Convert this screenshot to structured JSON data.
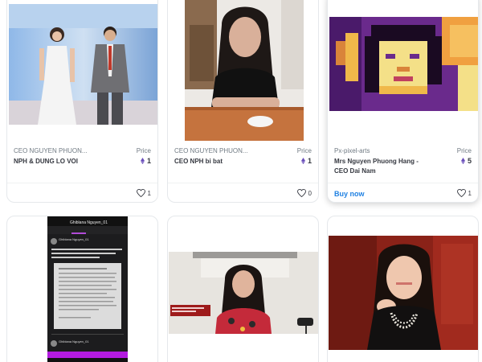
{
  "cards": [
    {
      "collection": "CEO NGUYEN PHUON...",
      "title": "NPH & DUNG LO VOI",
      "price_label": "Price",
      "price": "1",
      "likes": "1"
    },
    {
      "collection": "CEO NGUYEN PHUON...",
      "title": "CEO NPH bi bat",
      "price_label": "Price",
      "price": "1",
      "likes": "0"
    },
    {
      "collection": "Px-pixel-arts",
      "title": "Mrs Nguyen Phuong Hang - CEO Dai Nam",
      "price_label": "Price",
      "price": "5",
      "likes": "1",
      "buy_label": "Buy now"
    },
    {},
    {},
    {}
  ],
  "phone_shot": {
    "header_name": "Ghiblana Nguyen_01",
    "post_author": "Ghiblana Nguyen_01",
    "footer_author": "Ghiblana Nguyen_01"
  },
  "colors": {
    "eth": "#6b4fbb",
    "buy": "#2081e2",
    "border": "#e5e8eb"
  },
  "icons": [
    "heart-icon",
    "eth-icon"
  ]
}
